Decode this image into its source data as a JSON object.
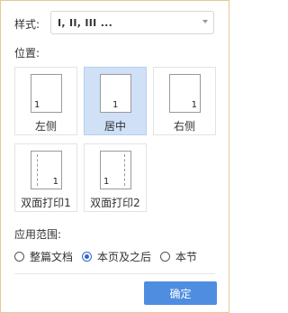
{
  "style": {
    "label": "样式:",
    "value": "I, II, III ..."
  },
  "position": {
    "label": "位置:",
    "options": [
      {
        "label": "左侧",
        "number": "1",
        "selected": false
      },
      {
        "label": "居中",
        "number": "1",
        "selected": true
      },
      {
        "label": "右侧",
        "number": "1",
        "selected": false
      },
      {
        "label": "双面打印1",
        "number": "1",
        "selected": false
      },
      {
        "label": "双面打印2",
        "number": "1",
        "selected": false
      }
    ]
  },
  "scope": {
    "label": "应用范围:",
    "options": [
      {
        "label": "整篇文档",
        "checked": false
      },
      {
        "label": "本页及之后",
        "checked": true
      },
      {
        "label": "本节",
        "checked": false
      }
    ]
  },
  "ok_label": "确定",
  "colors": {
    "accent": "#4f8de0",
    "selected_bg": "#cfe0f7",
    "frame_border": "#e8c894"
  }
}
